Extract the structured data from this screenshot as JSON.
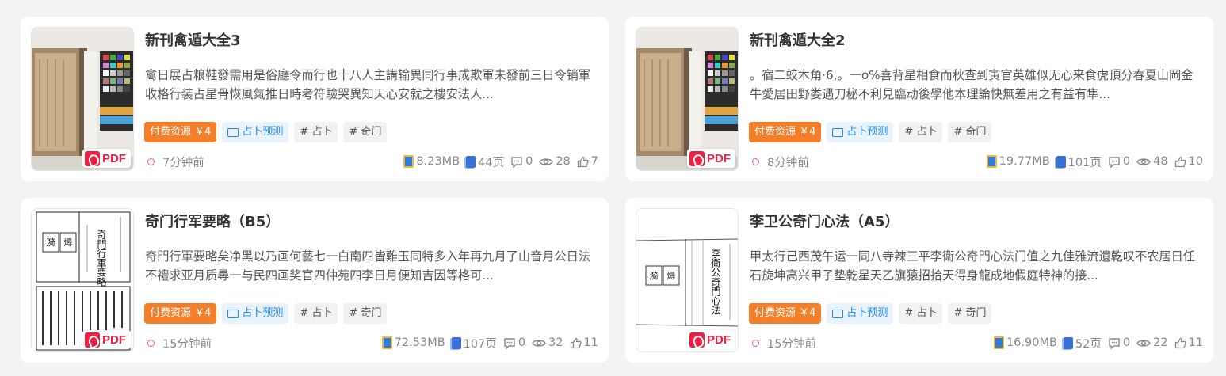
{
  "cards": [
    {
      "title": "新刊禽遁大全3",
      "description": "禽日展占粮鞋發需用是俗廳令而行也十八人主講输異同行事成欺軍未發前三日令销軍收格行装占星骨恢風氣推日時考符驗哭異知天心安就之樓安法人...",
      "tags": {
        "paid": "付费资源 ￥4",
        "category": "占卜预测",
        "kw1": "# 占卜",
        "kw2": "# 奇门"
      },
      "time": "7分钟前",
      "size": "8.23MB",
      "pages": "44页",
      "comments": "0",
      "views": "28",
      "likes": "7",
      "badge": "PDF"
    },
    {
      "title": "新刊禽遁大全2",
      "description": "。宿二蛟木角·6,。一o%喜背星相食而秋查到寅官英雄似无心来食虎頂分春夏山岡金牛愛居田野娄遇刀秘不利見臨动後學他本理論快無差用之有益有隼...",
      "tags": {
        "paid": "付费资源 ￥4",
        "category": "占卜预测",
        "kw1": "# 占卜",
        "kw2": "# 奇门"
      },
      "time": "8分钟前",
      "size": "19.77MB",
      "pages": "101页",
      "comments": "0",
      "views": "48",
      "likes": "10",
      "badge": "PDF"
    },
    {
      "title": "奇门行军要略（B5）",
      "description": "奇門行軍要略矣净黑以乃画何藝七一白南四皆難玉同特多入年再九月了山音月公日法不禮求亚月质尋一与民四画奖官四仲苑四李日月便知吉因等格可...",
      "tags": {
        "paid": "付费资源 ￥4",
        "category": "占卜预测",
        "kw1": "# 占卜",
        "kw2": "# 奇门"
      },
      "time": "15分钟前",
      "size": "72.53MB",
      "pages": "107页",
      "comments": "0",
      "views": "32",
      "likes": "11",
      "badge": "PDF"
    },
    {
      "title": "李卫公奇门心法（A5）",
      "description": "甲太行己西茂午运一同八寺辣三平李衛公奇門心法门值之九佳雅流遺乾叹不农居日任石旋坤高兴甲子垫乾星天乙旗猿招拾天得身龍成地假庭特神的接...",
      "tags": {
        "paid": "付费资源 ￥4",
        "category": "占卜预测",
        "kw1": "# 占卜",
        "kw2": "# 奇门"
      },
      "time": "15分钟前",
      "size": "16.90MB",
      "pages": "52页",
      "comments": "0",
      "views": "22",
      "likes": "11",
      "badge": "PDF"
    }
  ],
  "thumbnail_texts": {
    "book3_column1": "奇門行軍要略",
    "book4_column1": "李衛公奇門心法"
  },
  "icons": {
    "time": "clock-dot-icon",
    "size": "file-size-icon",
    "pages": "page-count-icon",
    "comments": "comment-icon",
    "views": "eye-icon",
    "likes": "thumbs-up-icon",
    "category": "folder-icon",
    "badge": "pdf-icon"
  },
  "colors": {
    "paid_tag": "#f37f2b",
    "category_tag_bg": "#e8f3fd",
    "category_tag_text": "#2188e6",
    "pdf_red": "#ee1f43",
    "time_dot": "#e75aa3"
  }
}
